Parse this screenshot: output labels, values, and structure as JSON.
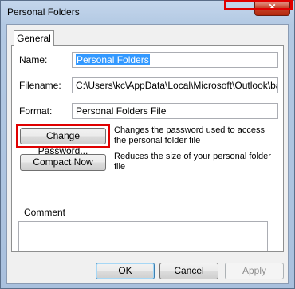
{
  "window": {
    "title": "Personal Folders",
    "close_glyph": "✕",
    "close_icon": "close-icon"
  },
  "tabs": [
    {
      "label": "General"
    }
  ],
  "fields": {
    "name_label": "Name:",
    "name_value": "Personal Folders",
    "filename_label": "Filename:",
    "filename_value": "C:\\Users\\kc\\AppData\\Local\\Microsoft\\Outlook\\backup",
    "format_label": "Format:",
    "format_value": "Personal Folders File"
  },
  "actions": {
    "change_password_label": "Change Password...",
    "change_password_desc": "Changes the password used to access the personal folder file",
    "compact_now_label": "Compact Now",
    "compact_now_desc": "Reduces the size of your personal folder file"
  },
  "comment": {
    "label": "Comment",
    "value": ""
  },
  "buttons": {
    "ok": "OK",
    "cancel": "Cancel",
    "apply": "Apply"
  },
  "colors": {
    "highlight": "#e00000",
    "selection": "#3399ff",
    "close_button": "#c7452c"
  }
}
